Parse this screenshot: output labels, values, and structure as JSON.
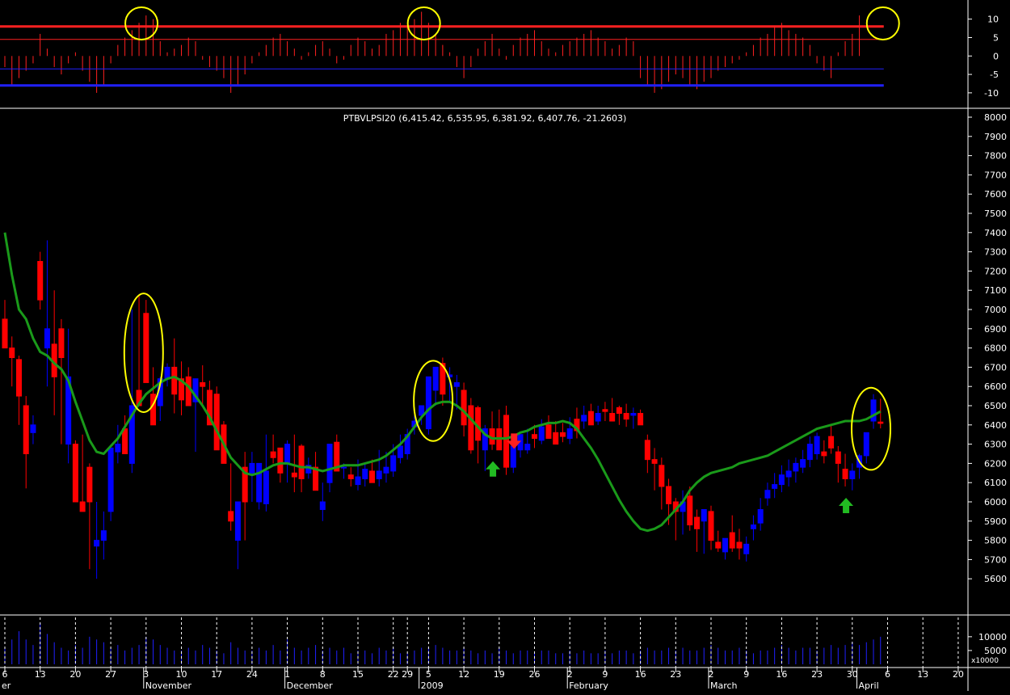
{
  "title": "PTBVLPSI20 (6,415.42, 6,535.95, 6,381.92, 6,407.76, -21.2603)",
  "colors": {
    "background": "#000000",
    "up": "#0000ff",
    "down": "#ff0000",
    "ma": "#1a9a1a",
    "osc_upper": "#ff2020",
    "osc_lower": "#2020ff",
    "highlight": "#ffff00",
    "arrow_buy": "#22bb22",
    "arrow_sell": "#ff2020",
    "axis_text": "#ffffff",
    "volume": "#2020ff"
  },
  "chart_data": [
    {
      "type": "bar",
      "name": "oscillator",
      "ylim": [
        -12,
        13
      ],
      "y_ticks": [
        10,
        5,
        0,
        -5,
        -10
      ],
      "upper_threshold": 8,
      "lower_threshold": -8,
      "upper_inner": 4.5,
      "lower_inner": -3.5,
      "x": [
        "2008-10-06",
        "2008-10-07",
        "2008-10-08",
        "2008-10-09",
        "2008-10-10",
        "2008-10-13",
        "2008-10-14",
        "2008-10-15",
        "2008-10-16",
        "2008-10-17",
        "2008-10-20",
        "2008-10-21",
        "2008-10-22",
        "2008-10-23",
        "2008-10-24",
        "2008-10-27",
        "2008-10-28",
        "2008-10-29",
        "2008-10-30",
        "2008-10-31",
        "2008-11-03",
        "2008-11-04",
        "2008-11-05",
        "2008-11-06",
        "2008-11-07",
        "2008-11-10",
        "2008-11-11",
        "2008-11-12",
        "2008-11-13",
        "2008-11-14",
        "2008-11-17",
        "2008-11-18",
        "2008-11-19",
        "2008-11-20",
        "2008-11-21",
        "2008-11-24",
        "2008-11-25",
        "2008-11-26",
        "2008-11-27",
        "2008-11-28",
        "2008-12-01",
        "2008-12-02",
        "2008-12-03",
        "2008-12-04",
        "2008-12-05",
        "2008-12-08",
        "2008-12-09",
        "2008-12-10",
        "2008-12-11",
        "2008-12-12",
        "2008-12-15",
        "2008-12-16",
        "2008-12-17",
        "2008-12-18",
        "2008-12-19",
        "2008-12-22",
        "2008-12-23",
        "2008-12-29",
        "2008-12-30",
        "2009-01-02",
        "2009-01-05",
        "2009-01-06",
        "2009-01-07",
        "2009-01-08",
        "2009-01-09",
        "2009-01-12",
        "2009-01-13",
        "2009-01-14",
        "2009-01-15",
        "2009-01-16",
        "2009-01-19",
        "2009-01-20",
        "2009-01-21",
        "2009-01-22",
        "2009-01-23",
        "2009-01-26",
        "2009-01-27",
        "2009-01-28",
        "2009-01-29",
        "2009-01-30",
        "2009-02-02",
        "2009-02-03",
        "2009-02-04",
        "2009-02-05",
        "2009-02-06",
        "2009-02-09",
        "2009-02-10",
        "2009-02-11",
        "2009-02-12",
        "2009-02-13",
        "2009-02-16",
        "2009-02-17",
        "2009-02-18",
        "2009-02-19",
        "2009-02-20",
        "2009-02-23",
        "2009-02-24",
        "2009-02-25",
        "2009-02-26",
        "2009-02-27",
        "2009-03-02",
        "2009-03-03",
        "2009-03-04",
        "2009-03-05",
        "2009-03-06",
        "2009-03-09",
        "2009-03-10",
        "2009-03-11",
        "2009-03-12",
        "2009-03-13",
        "2009-03-16",
        "2009-03-17",
        "2009-03-18",
        "2009-03-19",
        "2009-03-20",
        "2009-03-23",
        "2009-03-24",
        "2009-03-25",
        "2009-03-26",
        "2009-03-27",
        "2009-03-30",
        "2009-03-31",
        "2009-04-01",
        "2009-04-02",
        "2009-04-03"
      ],
      "values": [
        -3,
        -8,
        -6,
        -4,
        -2,
        6,
        2,
        -3,
        -5,
        -2,
        1,
        -4,
        -7,
        -10,
        -8,
        -2,
        3,
        5,
        7,
        9,
        11,
        10,
        4,
        1,
        2,
        3,
        5,
        4,
        -1,
        -3,
        -4,
        -6,
        -10,
        -8,
        -5,
        -2,
        1,
        3,
        5,
        6,
        4,
        2,
        -1,
        1,
        3,
        4,
        2,
        -2,
        -1,
        3,
        5,
        4,
        2,
        3,
        6,
        7,
        9,
        8,
        10,
        12,
        9,
        6,
        3,
        1,
        -3,
        -6,
        -3,
        2,
        4,
        6,
        2,
        -1,
        3,
        5,
        6,
        7,
        4,
        2,
        1,
        3,
        4,
        5,
        6,
        7,
        5,
        4,
        2,
        3,
        5,
        4,
        -6,
        -8,
        -10,
        -9,
        -7,
        -5,
        -6,
        -8,
        -9,
        -7,
        -6,
        -4,
        -3,
        -2,
        -1,
        1,
        3,
        5,
        6,
        8,
        9,
        7,
        6,
        5,
        3,
        -2,
        -4,
        -6,
        1,
        4,
        6,
        11
      ]
    },
    {
      "type": "candlestick",
      "name": "price",
      "series_label": "PTBVLPSI20",
      "ylim": [
        5500,
        8000
      ],
      "y_ticks": [
        8000,
        7900,
        7800,
        7700,
        7600,
        7500,
        7400,
        7300,
        7200,
        7100,
        7000,
        6900,
        6800,
        6700,
        6600,
        6500,
        6400,
        6300,
        6200,
        6100,
        6000,
        5900,
        5800,
        5700,
        5600
      ],
      "open": [
        6950,
        6800,
        6740,
        6500,
        6360,
        7250,
        6800,
        6820,
        6900,
        6300,
        6300,
        6000,
        6180,
        5770,
        5800,
        5950,
        6260,
        6380,
        6200,
        6580,
        6980,
        6560,
        6500,
        6640,
        6700,
        6640,
        6650,
        6520,
        6620,
        6580,
        6560,
        6400,
        5950,
        5800,
        6180,
        6150,
        6000,
        5990,
        6260,
        6280,
        6200,
        6150,
        6290,
        6150,
        6180,
        5960,
        6100,
        6310,
        6180,
        6140,
        6090,
        6120,
        6160,
        6120,
        6150,
        6160,
        6230,
        6250,
        6390,
        6450,
        6380,
        6580,
        6720,
        6650,
        6600,
        6580,
        6500,
        6490,
        6270,
        6380,
        6380,
        6450,
        6180,
        6270,
        6270,
        6350,
        6320,
        6400,
        6360,
        6360,
        6330,
        6430,
        6420,
        6470,
        6420,
        6480,
        6460,
        6490,
        6460,
        6450,
        6460,
        6320,
        6220,
        6190,
        6080,
        6000,
        5950,
        6030,
        5920,
        5900,
        5950,
        5790,
        5740,
        5840,
        5790,
        5730,
        5860,
        5890,
        6020,
        6070,
        6090,
        6130,
        6160,
        6180,
        6220,
        6250,
        6260,
        6340,
        6260,
        6170,
        6120,
        6180,
        6240,
        6420,
        6415
      ],
      "high": [
        7050,
        6860,
        6760,
        6550,
        6450,
        7300,
        7360,
        7100,
        6950,
        6900,
        6320,
        6350,
        6200,
        6000,
        5950,
        6280,
        6400,
        6450,
        7000,
        7070,
        7050,
        6700,
        6650,
        6720,
        6850,
        6730,
        6700,
        6640,
        6710,
        6630,
        6600,
        6420,
        6200,
        5950,
        6260,
        6260,
        6100,
        6350,
        6350,
        6280,
        6320,
        6350,
        6300,
        6230,
        6260,
        6100,
        6260,
        6350,
        6200,
        6180,
        6220,
        6200,
        6220,
        6270,
        6260,
        6300,
        6350,
        6380,
        6450,
        6470,
        6620,
        6700,
        6750,
        6700,
        6660,
        6620,
        6540,
        6500,
        6400,
        6470,
        6480,
        6500,
        6280,
        6340,
        6380,
        6400,
        6430,
        6450,
        6420,
        6410,
        6440,
        6490,
        6500,
        6510,
        6500,
        6520,
        6540,
        6500,
        6510,
        6490,
        6480,
        6350,
        6280,
        6230,
        6120,
        6020,
        6060,
        6080,
        5960,
        5950,
        5980,
        5850,
        5800,
        5930,
        5860,
        5820,
        5930,
        6020,
        6100,
        6150,
        6190,
        6220,
        6230,
        6270,
        6340,
        6360,
        6320,
        6400,
        6290,
        6250,
        6200,
        6250,
        6340,
        6560,
        6536
      ],
      "low": [
        6850,
        6600,
        6400,
        6070,
        6300,
        7000,
        6600,
        6450,
        6300,
        6200,
        6150,
        5950,
        5650,
        5600,
        5700,
        5900,
        6200,
        6250,
        6150,
        6500,
        6750,
        6460,
        6420,
        6600,
        6460,
        6450,
        6500,
        6260,
        6500,
        6450,
        6350,
        6200,
        5850,
        5650,
        5800,
        6000,
        5960,
        5950,
        6200,
        6100,
        6100,
        6050,
        6050,
        6120,
        6100,
        5900,
        6050,
        6200,
        6120,
        6080,
        6060,
        6080,
        6110,
        6080,
        6100,
        6130,
        6200,
        6220,
        6350,
        6400,
        6350,
        6500,
        6500,
        6520,
        6480,
        6340,
        6250,
        6200,
        6160,
        6270,
        6320,
        6140,
        6150,
        6230,
        6250,
        6280,
        6300,
        6340,
        6320,
        6310,
        6300,
        6330,
        6380,
        6400,
        6400,
        6420,
        6420,
        6400,
        6390,
        6380,
        6400,
        6150,
        6060,
        5960,
        5880,
        5800,
        5830,
        5850,
        5740,
        5730,
        5750,
        5740,
        5700,
        5740,
        5700,
        5690,
        5800,
        5850,
        5980,
        6020,
        6050,
        6080,
        6100,
        6150,
        6180,
        6220,
        6200,
        6250,
        6100,
        6080,
        6060,
        6120,
        6200,
        6380,
        6382
      ],
      "close": [
        6800,
        6750,
        6550,
        6250,
        6400,
        7050,
        6900,
        6650,
        6750,
        6650,
        6000,
        5950,
        6000,
        5800,
        5850,
        6280,
        6300,
        6250,
        6500,
        6500,
        6620,
        6400,
        6640,
        6700,
        6560,
        6530,
        6500,
        6640,
        6600,
        6400,
        6270,
        6200,
        5900,
        6000,
        6000,
        6200,
        6200,
        6160,
        6230,
        6150,
        6300,
        6130,
        6120,
        6190,
        6060,
        6000,
        6300,
        6160,
        6180,
        6120,
        6130,
        6170,
        6100,
        6160,
        6180,
        6240,
        6290,
        6350,
        6420,
        6500,
        6650,
        6700,
        6560,
        6660,
        6620,
        6400,
        6270,
        6320,
        6380,
        6300,
        6270,
        6180,
        6290,
        6350,
        6300,
        6330,
        6390,
        6330,
        6300,
        6340,
        6380,
        6370,
        6450,
        6400,
        6460,
        6470,
        6420,
        6460,
        6430,
        6460,
        6400,
        6220,
        6200,
        6080,
        5990,
        5950,
        6000,
        5880,
        5860,
        5960,
        5800,
        5760,
        5810,
        5760,
        5760,
        5780,
        5880,
        5960,
        6060,
        6090,
        6140,
        6160,
        6200,
        6220,
        6300,
        6340,
        6240,
        6280,
        6200,
        6120,
        6160,
        6240,
        6360,
        6530,
        6408
      ],
      "ma_label": "",
      "ma": [
        7400,
        7180,
        7000,
        6950,
        6850,
        6780,
        6760,
        6720,
        6690,
        6630,
        6520,
        6420,
        6320,
        6260,
        6250,
        6290,
        6330,
        6390,
        6450,
        6510,
        6560,
        6590,
        6620,
        6640,
        6650,
        6630,
        6600,
        6550,
        6500,
        6440,
        6370,
        6300,
        6230,
        6190,
        6150,
        6140,
        6150,
        6170,
        6190,
        6200,
        6200,
        6190,
        6180,
        6180,
        6170,
        6160,
        6170,
        6180,
        6190,
        6190,
        6190,
        6200,
        6210,
        6220,
        6240,
        6270,
        6300,
        6340,
        6390,
        6440,
        6480,
        6510,
        6520,
        6520,
        6500,
        6470,
        6430,
        6390,
        6350,
        6330,
        6330,
        6330,
        6340,
        6360,
        6370,
        6390,
        6400,
        6410,
        6410,
        6420,
        6410,
        6380,
        6330,
        6280,
        6220,
        6150,
        6080,
        6010,
        5950,
        5900,
        5860,
        5850,
        5860,
        5880,
        5920,
        5960,
        6000,
        6060,
        6100,
        6130,
        6150,
        6160,
        6170,
        6180,
        6200,
        6210,
        6220,
        6230,
        6240,
        6260,
        6280,
        6300,
        6320,
        6340,
        6360,
        6380,
        6390,
        6400,
        6410,
        6420,
        6420,
        6420,
        6430,
        6450,
        6470
      ]
    },
    {
      "type": "bar",
      "name": "volume",
      "y_ticks": [
        10000,
        5000
      ],
      "ylim": [
        0,
        17000
      ],
      "y_unit_label": "x10000",
      "values": [
        6000,
        9000,
        12000,
        9000,
        7000,
        15000,
        11000,
        8000,
        6000,
        5000,
        7000,
        6000,
        10000,
        9000,
        8000,
        6000,
        7000,
        5000,
        6000,
        7000,
        10000,
        9000,
        7000,
        6000,
        5000,
        5000,
        6000,
        5000,
        7000,
        6000,
        5000,
        4000,
        8000,
        6000,
        5000,
        5000,
        6000,
        5000,
        7000,
        5000,
        9000,
        6000,
        5000,
        6000,
        7000,
        5000,
        6000,
        5000,
        6000,
        4000,
        5000,
        5000,
        4000,
        6000,
        5000,
        6000,
        4000,
        4000,
        5000,
        6000,
        6000,
        7000,
        6000,
        5000,
        5000,
        6000,
        5000,
        4000,
        5000,
        4000,
        6000,
        5000,
        4000,
        5000,
        5000,
        4000,
        5000,
        5000,
        4000,
        4000,
        5000,
        4000,
        5000,
        4000,
        4000,
        5000,
        4000,
        5000,
        5000,
        4000,
        5000,
        6000,
        5000,
        5000,
        6000,
        5000,
        6000,
        5000,
        5000,
        6000,
        7000,
        6000,
        5000,
        5000,
        6000,
        5000,
        4000,
        5000,
        5000,
        6000,
        7000,
        6000,
        5000,
        6000,
        6000,
        5000,
        6000,
        7000,
        6000,
        7000,
        8000,
        7000,
        8000,
        9000,
        10000
      ]
    }
  ],
  "x_axis": {
    "day_labels": [
      "6",
      "13",
      "20",
      "27",
      "3",
      "10",
      "17",
      "24",
      "1",
      "8",
      "15",
      "22",
      "29",
      "5",
      "12",
      "19",
      "26",
      "2",
      "9",
      "16",
      "23",
      "2",
      "9",
      "16",
      "23",
      "30",
      "6",
      "13",
      "20"
    ],
    "day_label_index": [
      0,
      5,
      10,
      15,
      20,
      25,
      30,
      35,
      40,
      45,
      50,
      55,
      57,
      60,
      65,
      70,
      75,
      80,
      85,
      90,
      95,
      100,
      105,
      110,
      115,
      120,
      125,
      130,
      135
    ],
    "month_labels": [
      "er",
      "November",
      "December",
      "2009",
      "February",
      "March",
      "April"
    ],
    "month_label_index": [
      -1,
      20,
      40,
      59,
      80,
      100,
      121
    ]
  },
  "annotations": {
    "highlight_ellipse_indices": [
      20,
      61,
      123
    ],
    "osc_circle_indices": [
      19,
      59,
      124
    ],
    "buy_arrow_indices": [
      69,
      119
    ],
    "sell_arrow_indices": [
      72
    ]
  }
}
